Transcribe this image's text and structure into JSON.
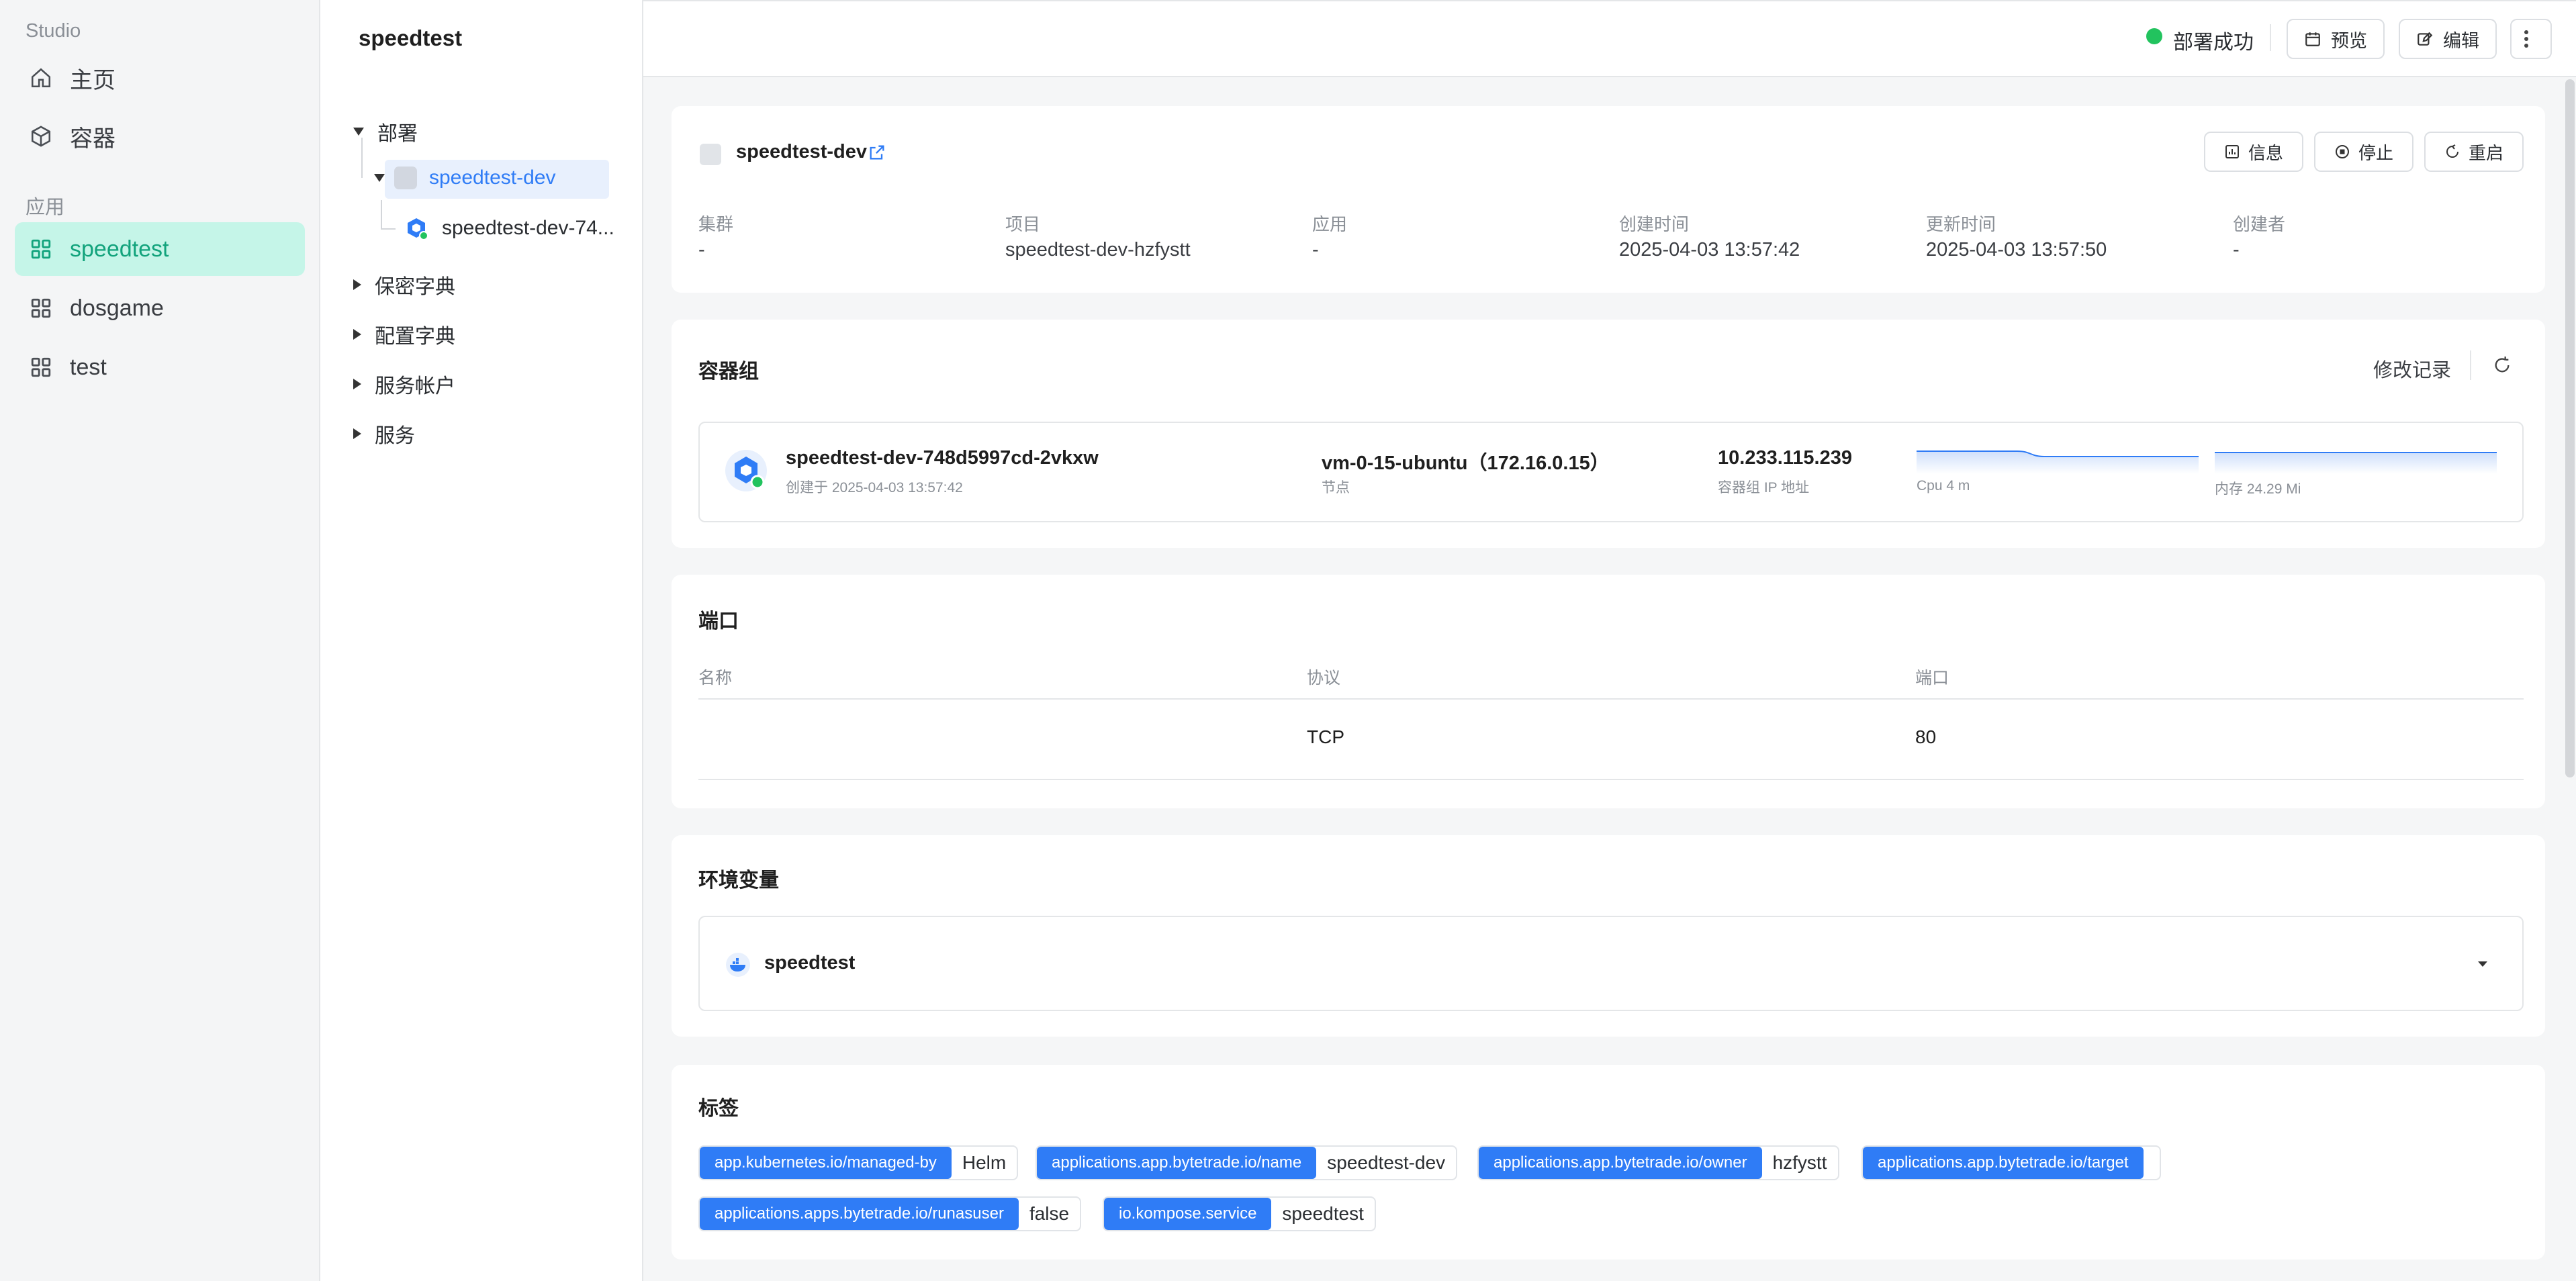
{
  "sidebar": {
    "section_studio": "Studio",
    "home": "主页",
    "containers": "容器",
    "section_apps": "应用",
    "apps": [
      {
        "label": "speedtest",
        "active": true
      },
      {
        "label": "dosgame",
        "active": false
      },
      {
        "label": "test",
        "active": false
      }
    ]
  },
  "header": {
    "app_name": "speedtest",
    "status": "部署成功",
    "status_color": "#22c35e",
    "preview": "预览",
    "edit": "编辑"
  },
  "tree": {
    "deployment": "部署",
    "deployment_item": "speedtest-dev",
    "pod_item": "speedtest-dev-74...",
    "secrets": "保密字典",
    "configmaps": "配置字典",
    "service_accounts": "服务帐户",
    "services": "服务"
  },
  "deploy_card": {
    "name": "speedtest-dev",
    "info_btn": "信息",
    "stop_btn": "停止",
    "restart_btn": "重启",
    "meta": [
      {
        "label": "集群",
        "value": "-"
      },
      {
        "label": "项目",
        "value": "speedtest-dev-hzfystt"
      },
      {
        "label": "应用",
        "value": "-"
      },
      {
        "label": "创建时间",
        "value": "2025-04-03 13:57:42"
      },
      {
        "label": "更新时间",
        "value": "2025-04-03 13:57:50"
      },
      {
        "label": "创建者",
        "value": "-"
      }
    ]
  },
  "pods_card": {
    "title": "容器组",
    "history": "修改记录",
    "pod": {
      "name": "speedtest-dev-748d5997cd-2vkxw",
      "created": "创建于 2025-04-03 13:57:42",
      "node": "vm-0-15-ubuntu（172.16.0.15）",
      "node_label": "节点",
      "ip": "10.233.115.239",
      "ip_label": "容器组 IP 地址",
      "cpu": "Cpu 4 m",
      "mem": "内存 24.29 Mi"
    }
  },
  "ports_card": {
    "title": "端口",
    "headers": [
      "名称",
      "协议",
      "端口"
    ],
    "rows": [
      {
        "name": "",
        "protocol": "TCP",
        "port": "80"
      }
    ]
  },
  "env_card": {
    "title": "环境变量",
    "container": "speedtest"
  },
  "labels_card": {
    "title": "标签",
    "labels": [
      {
        "key": "app.kubernetes.io/managed-by",
        "value": "Helm"
      },
      {
        "key": "applications.app.bytetrade.io/name",
        "value": "speedtest-dev"
      },
      {
        "key": "applications.app.bytetrade.io/owner",
        "value": "hzfystt"
      },
      {
        "key": "applications.app.bytetrade.io/target",
        "value": ""
      },
      {
        "key": "applications.apps.bytetrade.io/runasuser",
        "value": "false"
      },
      {
        "key": "io.kompose.service",
        "value": "speedtest"
      }
    ]
  }
}
